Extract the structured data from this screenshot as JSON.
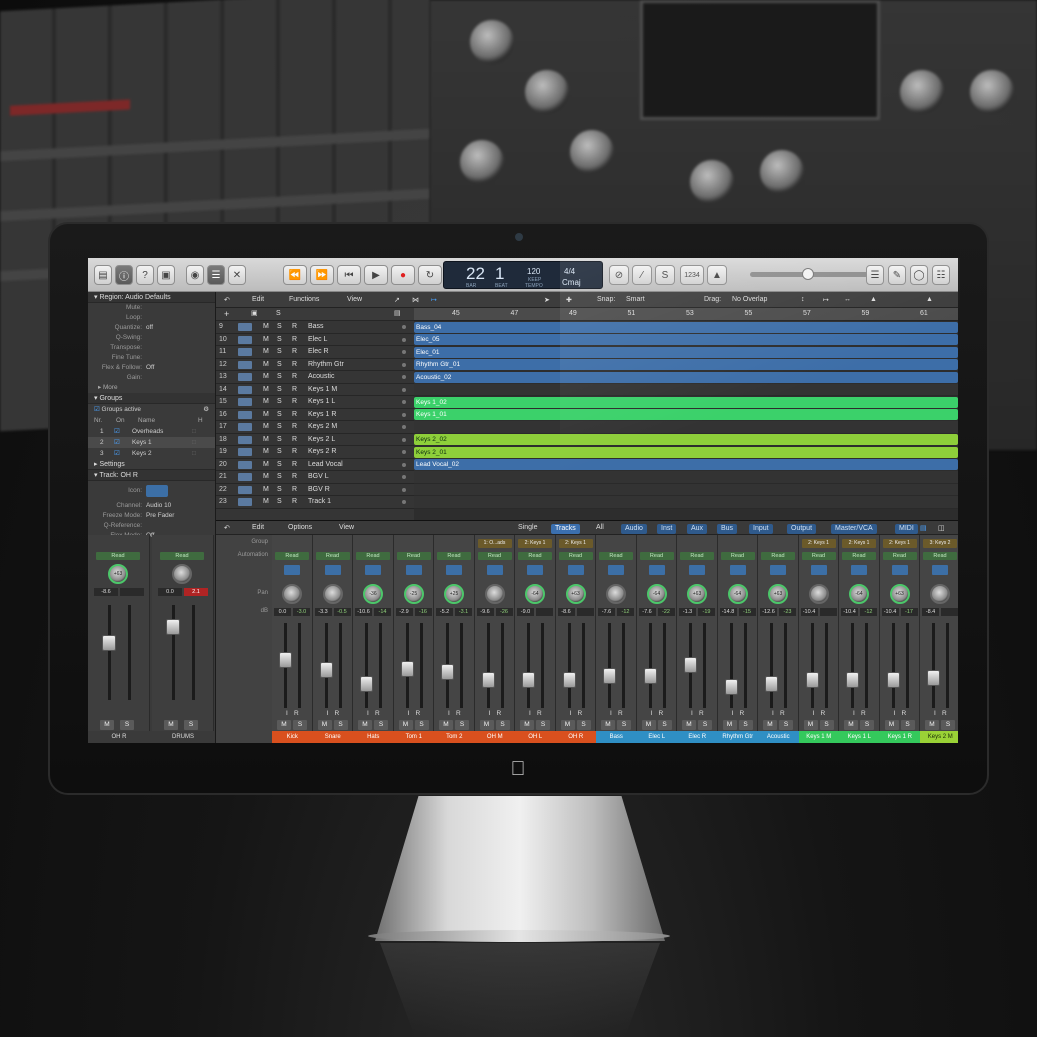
{
  "colors": {
    "region_blue": "#3d6ea8",
    "region_green": "#3bd16a",
    "region_lime": "#8ecf3a",
    "strip_drums": "#d9501e",
    "strip_guitar": "#2f8fc4",
    "strip_keys": "#34c95c",
    "strip_keys_lime": "#9ad236"
  },
  "control_bar": {
    "lcd": {
      "bar": "22",
      "beat": "1",
      "bar_label": "BAR",
      "beat_label": "BEAT",
      "tempo": "120",
      "keep": "KEEP",
      "tempo_label": "TEMPO",
      "sig": "4/4",
      "key": "Cmaj"
    },
    "count_in": "1234"
  },
  "inspector": {
    "region_header": "Region: Audio Defaults",
    "region_rows": [
      {
        "k": "Mute:",
        "v": ""
      },
      {
        "k": "Loop:",
        "v": ""
      },
      {
        "k": "Quantize:",
        "v": "off"
      },
      {
        "k": "Q-Swing:",
        "v": ""
      },
      {
        "k": "Transpose:",
        "v": ""
      },
      {
        "k": "Fine Tune:",
        "v": ""
      },
      {
        "k": "Flex & Follow:",
        "v": "Off"
      },
      {
        "k": "Gain:",
        "v": ""
      }
    ],
    "more": "More",
    "groups_header": "Groups",
    "groups_active": "Groups active",
    "group_cols": {
      "nr": "Nr.",
      "on": "On",
      "name": "Name",
      "h": "H"
    },
    "groups": [
      {
        "nr": "1",
        "name": "Overheads"
      },
      {
        "nr": "2",
        "name": "Keys 1"
      },
      {
        "nr": "3",
        "name": "Keys 2"
      }
    ],
    "settings": "Settings",
    "track_header": "Track: OH R",
    "track_rows": [
      {
        "k": "Icon:",
        "v": ""
      },
      {
        "k": "Channel:",
        "v": "Audio 10"
      },
      {
        "k": "Freeze Mode:",
        "v": "Pre Fader"
      },
      {
        "k": "Q-Reference:",
        "v": ""
      },
      {
        "k": "Flex Mode:",
        "v": "Off"
      }
    ],
    "strips": [
      {
        "read": "Read",
        "knob": "+63",
        "db": "-8.6",
        "db2": "",
        "name": "OH R"
      },
      {
        "read": "Read",
        "knob": "",
        "db": "0.0",
        "db2": "2.1",
        "name": "DRUMS"
      }
    ]
  },
  "track_header": {
    "edit": "Edit",
    "functions": "Functions",
    "view": "View",
    "snap_label": "Snap:",
    "snap": "Smart",
    "drag_label": "Drag:",
    "drag": "No Overlap"
  },
  "ruler": [
    "45",
    "47",
    "49",
    "51",
    "53",
    "55",
    "57",
    "59",
    "61"
  ],
  "tracks": [
    {
      "num": "9",
      "name": "Bass",
      "region": "Bass_04",
      "color": "blue"
    },
    {
      "num": "10",
      "name": "Elec L",
      "region": "Elec_05",
      "color": "blue"
    },
    {
      "num": "11",
      "name": "Elec R",
      "region": "Elec_01",
      "color": "blue"
    },
    {
      "num": "12",
      "name": "Rhythm Gtr",
      "region": "Rhythm Gtr_01",
      "color": "blue"
    },
    {
      "num": "13",
      "name": "Acoustic",
      "region": "Acoustic_02",
      "color": "blue"
    },
    {
      "num": "14",
      "name": "Keys 1 M",
      "region": "",
      "color": "none"
    },
    {
      "num": "15",
      "name": "Keys 1 L",
      "region": "Keys 1_02",
      "color": "green"
    },
    {
      "num": "16",
      "name": "Keys 1 R",
      "region": "Keys 1_01",
      "color": "green"
    },
    {
      "num": "17",
      "name": "Keys 2 M",
      "region": "",
      "color": "none"
    },
    {
      "num": "18",
      "name": "Keys 2 L",
      "region": "Keys 2_02",
      "color": "lime"
    },
    {
      "num": "19",
      "name": "Keys 2 R",
      "region": "Keys 2_01",
      "color": "lime"
    },
    {
      "num": "20",
      "name": "Lead Vocal",
      "region": "Lead Vocal_02",
      "color": "blue"
    },
    {
      "num": "21",
      "name": "BGV L",
      "region": "",
      "color": "none"
    },
    {
      "num": "22",
      "name": "BGV R",
      "region": "",
      "color": "none"
    },
    {
      "num": "23",
      "name": "Track 1",
      "region": "",
      "color": "none"
    }
  ],
  "mixer_header": {
    "edit": "Edit",
    "options": "Options",
    "view": "View",
    "single": "Single",
    "tracks": "Tracks",
    "all": "All",
    "filters": [
      "Audio",
      "Inst",
      "Aux",
      "Bus",
      "Input",
      "Output",
      "Master/VCA",
      "MIDI"
    ]
  },
  "mixer_labels": {
    "group": "Group",
    "automation": "Automation",
    "pan": "Pan",
    "db": "dB"
  },
  "strips": [
    {
      "grp": "",
      "knob": "",
      "db": "0.0",
      "db2": "-3.0",
      "name": "Kick",
      "color": "drums",
      "fader": 0.62
    },
    {
      "grp": "",
      "knob": "",
      "db": "-3.3",
      "db2": "-0.5",
      "name": "Snare",
      "color": "drums",
      "fader": 0.48
    },
    {
      "grp": "",
      "knob": "-36",
      "db": "-10.6",
      "db2": "-14",
      "name": "Hats",
      "color": "drums",
      "fader": 0.3
    },
    {
      "grp": "",
      "knob": "-25",
      "db": "-2.9",
      "db2": "-16",
      "name": "Tom 1",
      "color": "drums",
      "fader": 0.5
    },
    {
      "grp": "",
      "knob": "+25",
      "db": "-5.2",
      "db2": "-3.1",
      "name": "Tom 2",
      "color": "drums",
      "fader": 0.45
    },
    {
      "grp": "1: O...ads",
      "knob": "",
      "db": "-9.6",
      "db2": "-26",
      "name": "OH M",
      "color": "drums",
      "fader": 0.35
    },
    {
      "grp": "2: Keys 1",
      "knob": "-64",
      "db": "-9.0",
      "db2": "",
      "name": "OH L",
      "color": "drums",
      "fader": 0.35
    },
    {
      "grp": "2: Keys 1",
      "knob": "+63",
      "db": "-8.6",
      "db2": "",
      "name": "OH R",
      "color": "drums",
      "fader": 0.35
    },
    {
      "grp": "",
      "knob": "",
      "db": "-7.6",
      "db2": "-12",
      "name": "Bass",
      "color": "guitar",
      "fader": 0.4
    },
    {
      "grp": "",
      "knob": "-64",
      "db": "-7.6",
      "db2": "-22",
      "name": "Elec L",
      "color": "guitar",
      "fader": 0.4
    },
    {
      "grp": "",
      "knob": "+63",
      "db": "-1.3",
      "db2": "-19",
      "name": "Elec R",
      "color": "guitar",
      "fader": 0.55
    },
    {
      "grp": "",
      "knob": "-64",
      "db": "-14.8",
      "db2": "-15",
      "name": "Rhythm Gtr",
      "color": "guitar",
      "fader": 0.25
    },
    {
      "grp": "",
      "knob": "+63",
      "db": "-12.6",
      "db2": "-23",
      "name": "Acoustic",
      "color": "guitar",
      "fader": 0.3
    },
    {
      "grp": "2: Keys 1",
      "knob": "",
      "db": "-10.4",
      "db2": "",
      "name": "Keys 1 M",
      "color": "keys",
      "fader": 0.35
    },
    {
      "grp": "2: Keys 1",
      "knob": "-64",
      "db": "-10.4",
      "db2": "-12",
      "name": "Keys 1 L",
      "color": "keys",
      "fader": 0.35
    },
    {
      "grp": "2: Keys 1",
      "knob": "+63",
      "db": "-10.4",
      "db2": "-17",
      "name": "Keys 1 R",
      "color": "keys",
      "fader": 0.35
    },
    {
      "grp": "3: Keys 2",
      "knob": "",
      "db": "-8.4",
      "db2": "",
      "name": "Keys 2 M",
      "color": "lime",
      "fader": 0.38
    }
  ]
}
